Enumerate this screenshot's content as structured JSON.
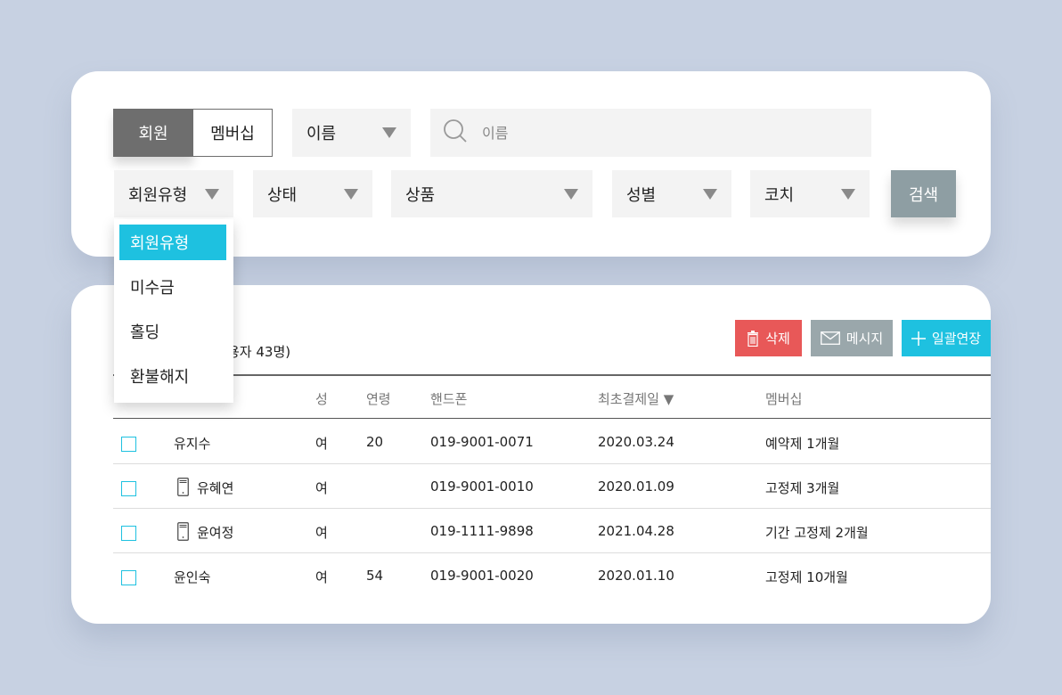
{
  "toggle": {
    "active": "회원",
    "inactive": "멤버십"
  },
  "search_field_select": {
    "value": "이름"
  },
  "search_input": {
    "placeholder": "이름"
  },
  "filters": {
    "member_type": "회원유형",
    "status": "상태",
    "product": "상품",
    "gender": "성별",
    "coach": "코치"
  },
  "search_button": "검색",
  "dropdown": {
    "items": [
      "회원유형",
      "미수금",
      "홀딩",
      "환불해지"
    ],
    "selected_index": 0
  },
  "actions": {
    "delete": "삭제",
    "message": "메시지",
    "bulk_extend": "일괄연장"
  },
  "count_text": "용자 43명)",
  "table": {
    "headers": {
      "gender": "성",
      "age": "연령",
      "phone": "핸드폰",
      "first_payment": "최초결제일 ▼",
      "membership": "멤버십"
    },
    "rows": [
      {
        "name": "유지수",
        "app": false,
        "gender": "여",
        "age": "20",
        "phone": "019-9001-0071",
        "first_payment": "2020.03.24",
        "membership": "예약제 1개월"
      },
      {
        "name": "유혜연",
        "app": true,
        "gender": "여",
        "age": "",
        "phone": "019-9001-0010",
        "first_payment": "2020.01.09",
        "membership": "고정제 3개월"
      },
      {
        "name": "윤여정",
        "app": true,
        "gender": "여",
        "age": "",
        "phone": "019-1111-9898",
        "first_payment": "2021.04.28",
        "membership": "기간 고정제 2개월"
      },
      {
        "name": "윤인숙",
        "app": false,
        "gender": "여",
        "age": "54",
        "phone": "019-9001-0020",
        "first_payment": "2020.01.10",
        "membership": "고정제 10개월"
      }
    ]
  },
  "colors": {
    "accent": "#1ec1e0",
    "danger": "#e85858",
    "muted_button": "#9aa7ab",
    "background": "#c7d1e2"
  }
}
